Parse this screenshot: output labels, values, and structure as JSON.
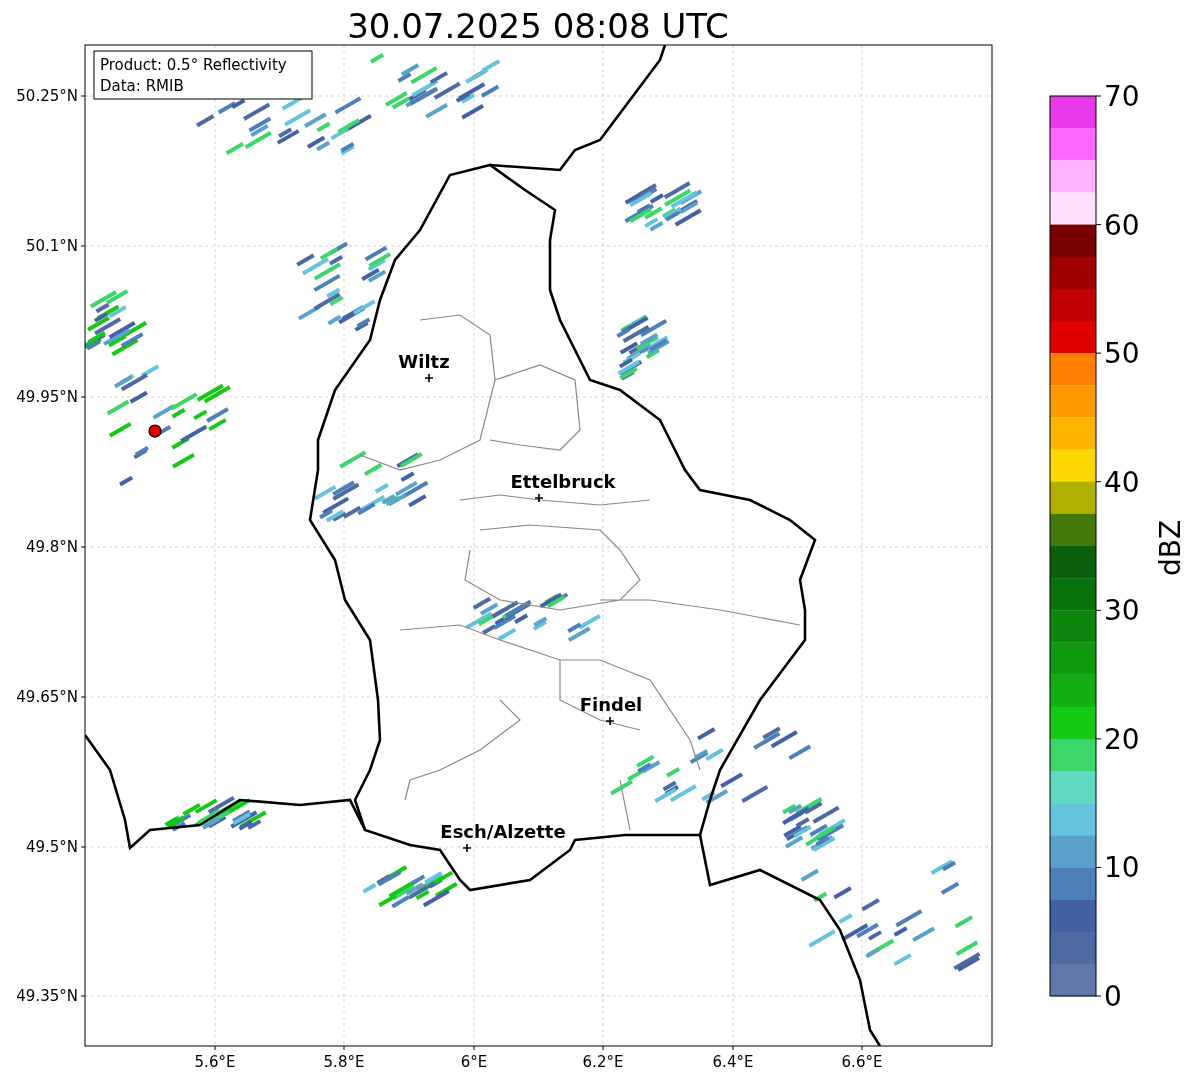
{
  "title": "30.07.2025 08:08 UTC",
  "info_box": [
    "Product: 0.5° Reflectivity",
    "Data: RMIB"
  ],
  "x_ticks": [
    "5.6°E",
    "5.8°E",
    "6°E",
    "6.2°E",
    "6.4°E",
    "6.6°E"
  ],
  "y_ticks": [
    "50.25°N",
    "50.1°N",
    "49.95°N",
    "49.8°N",
    "49.65°N",
    "49.5°N",
    "49.35°N"
  ],
  "cities": [
    {
      "name": "Wiltz"
    },
    {
      "name": "Ettelbruck"
    },
    {
      "name": "Findel"
    },
    {
      "name": "Esch/Alzette"
    }
  ],
  "colorbar": {
    "label": "dBZ",
    "ticks": [
      "70",
      "60",
      "50",
      "40",
      "30",
      "20",
      "10",
      "0"
    ],
    "segments": [
      {
        "color": "#e83ae8"
      },
      {
        "color": "#ff66ff"
      },
      {
        "color": "#ffb3ff"
      },
      {
        "color": "#ffe0ff"
      },
      {
        "color": "#780000"
      },
      {
        "color": "#a00000"
      },
      {
        "color": "#c00000"
      },
      {
        "color": "#e00000"
      },
      {
        "color": "#ff8000"
      },
      {
        "color": "#ff9a00"
      },
      {
        "color": "#ffb400"
      },
      {
        "color": "#ffd700"
      },
      {
        "color": "#b0b000"
      },
      {
        "color": "#437a0b"
      },
      {
        "color": "#0b5e0b"
      },
      {
        "color": "#0a720a"
      },
      {
        "color": "#0c860c"
      },
      {
        "color": "#0f9a0f"
      },
      {
        "color": "#12ae12"
      },
      {
        "color": "#14c814"
      },
      {
        "color": "#3cd66a"
      },
      {
        "color": "#60d9c3"
      },
      {
        "color": "#65c3dd"
      },
      {
        "color": "#5aa2cb"
      },
      {
        "color": "#4d7fb8"
      },
      {
        "color": "#4361a4"
      },
      {
        "color": "#4e6aa3"
      },
      {
        "color": "#6177aa"
      }
    ]
  }
}
